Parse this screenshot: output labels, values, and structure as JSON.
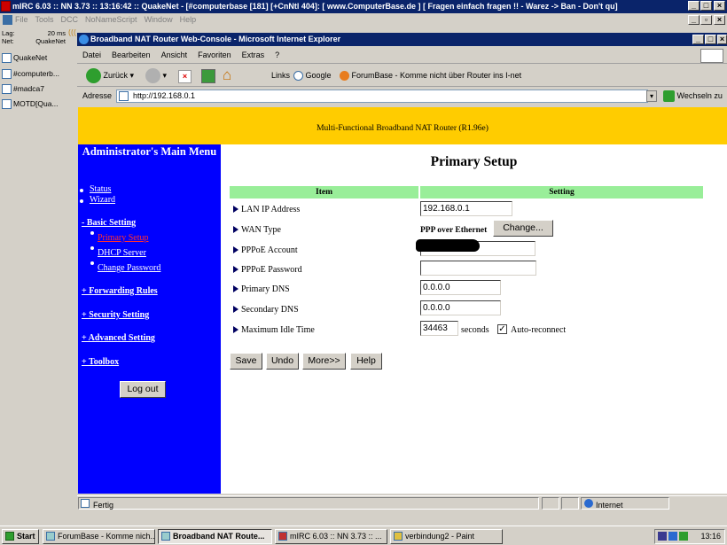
{
  "mirc": {
    "title": "mIRC 6.03 :: NN 3.73 :: 13:16:42 :: QuakeNet - [#computerbase [181] [+CnNtl 404]: [ www.ComputerBase.de ] [ Fragen einfach fragen !! - Warez -> Ban - Don't qu]",
    "menu": [
      "File",
      "Tools",
      "DCC",
      "NoNameScript",
      "Window",
      "Help"
    ],
    "lag_label": "Lag:",
    "lag_value": "20 ms",
    "net_label": "Net:",
    "net_value": "QuakeNet",
    "channels": [
      "QuakeNet",
      "#computerb...",
      "#madca7",
      "MOTD[Qua..."
    ]
  },
  "ie": {
    "title": "Broadband NAT Router Web-Console - Microsoft Internet Explorer",
    "menu": [
      "Datei",
      "Bearbeiten",
      "Ansicht",
      "Favoriten",
      "Extras",
      "?"
    ],
    "back_label": "Zurück",
    "links_label": "Links",
    "google_label": "Google",
    "forumbase_label": "ForumBase - Komme nicht über Router ins I-net",
    "address_label": "Adresse",
    "address_value": "http://192.168.0.1",
    "go_label": "Wechseln zu",
    "status_text": "Fertig",
    "zone_text": "Internet"
  },
  "page": {
    "banner": "Multi-Functional Broadband NAT Router (R1.96e)",
    "nav_title": "Administrator's Main Menu",
    "nav": {
      "status": "Status",
      "wizard": "Wizard",
      "basic": "- Basic Setting",
      "primary": "Primary Setup",
      "dhcp": "DHCP Server",
      "change_pw": "Change Password",
      "forwarding": "+ Forwarding Rules",
      "security": "+ Security Setting",
      "advanced": "+ Advanced Setting",
      "toolbox": "+ Toolbox"
    },
    "logout_label": "Log out",
    "title": "Primary Setup",
    "col_item": "Item",
    "col_setting": "Setting",
    "rows": {
      "lan_label": "LAN IP Address",
      "lan_value": "192.168.0.1",
      "wan_label": "WAN Type",
      "wan_value": "PPP over Ethernet",
      "change_label": "Change...",
      "account_label": "PPPoE Account",
      "account_value": "",
      "password_label": "PPPoE Password",
      "password_value": "",
      "dns1_label": "Primary DNS",
      "dns1_value": "0.0.0.0",
      "dns2_label": "Secondary DNS",
      "dns2_value": "0.0.0.0",
      "idle_label": "Maximum Idle Time",
      "idle_value": "34463",
      "idle_unit": "seconds",
      "auto_reconnect_label": "Auto-reconnect",
      "auto_reconnect_checked": "✓"
    },
    "buttons": {
      "save": "Save",
      "undo": "Undo",
      "more": "More>>",
      "help": "Help"
    }
  },
  "taskbar": {
    "start": "Start",
    "tasks": [
      "ForumBase - Komme nich...",
      "Broadband NAT Route...",
      "mIRC 6.03 :: NN 3.73 :: ...",
      "verbindung2 - Paint"
    ],
    "clock": "13:16"
  }
}
